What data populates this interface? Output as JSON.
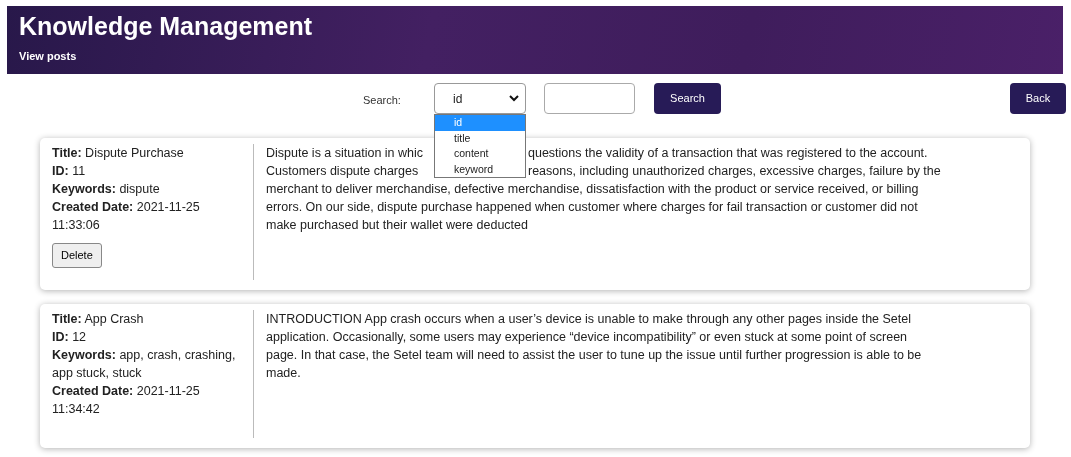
{
  "header": {
    "title": "Knowledge Management",
    "link": "View posts"
  },
  "search": {
    "label": "Search:",
    "select": {
      "value": "id",
      "expanded": true,
      "options": [
        {
          "label": "id",
          "selected": true
        },
        {
          "label": "title",
          "selected": false
        },
        {
          "label": "content",
          "selected": false
        },
        {
          "label": "keyword",
          "selected": false
        }
      ]
    },
    "button": "Search"
  },
  "back_button": "Back",
  "posts": [
    {
      "fields": [
        {
          "label": "Title:",
          "value": "Dispute Purchase"
        },
        {
          "label": "ID:",
          "value": "11"
        },
        {
          "label": "Keywords:",
          "value": "dispute"
        },
        {
          "label": "Created Date:",
          "value": "2021-11-25 11:33:06"
        }
      ],
      "delete_button": "Delete",
      "content_lines": [
        [
          "Dispute is a situation in whic",
          "questions the validity of a transaction that was registered to the account."
        ],
        [
          "Customers dispute charges",
          "reasons, including unauthorized charges, excessive charges, failure by the"
        ],
        [
          "merchant to deliver merchandise, defective merchandise, dissatisfaction with the product or service received, or billing"
        ],
        [
          "errors. On our side, dispute purchase happened when customer where charges for fail transaction or customer did not"
        ],
        [
          "make purchased but their wallet were deducted"
        ]
      ]
    },
    {
      "fields": [
        {
          "label": "Title:",
          "value": "App Crash"
        },
        {
          "label": "ID:",
          "value": "12"
        },
        {
          "label": "Keywords:",
          "value": "app, crash, crashing, app stuck, stuck"
        },
        {
          "label": "Created Date:",
          "value": "2021-11-25 11:34:42"
        }
      ],
      "content_lines": [
        [
          "INTRODUCTION App crash occurs when a user’s device is unable to make through any other pages inside the Setel"
        ],
        [
          "application. Occasionally, some users may experience “device incompatibility” or even stuck at some point of screen"
        ],
        [
          "page. In that case, the Setel team will need to assist the user to tune up the issue until further progression is able to be"
        ],
        [
          "made."
        ]
      ]
    }
  ]
}
